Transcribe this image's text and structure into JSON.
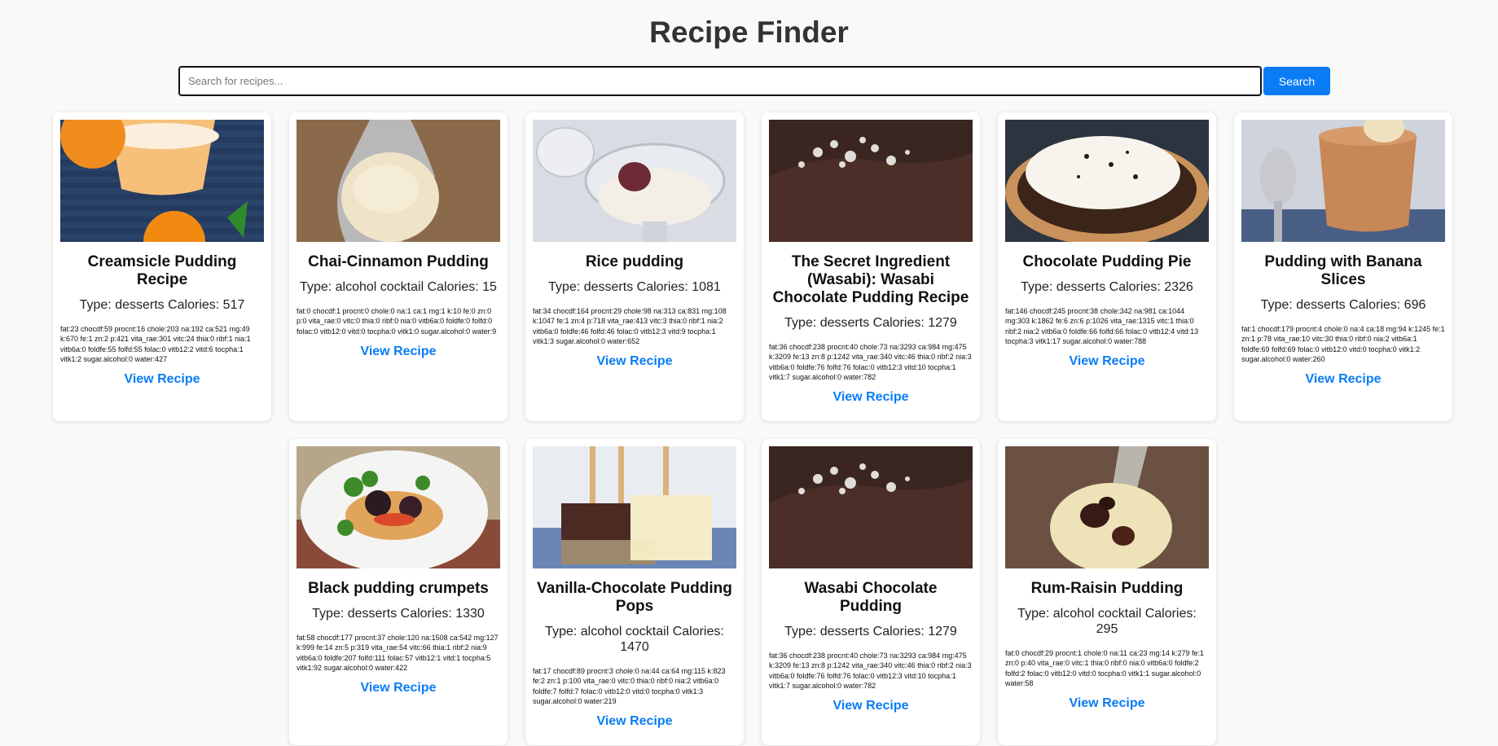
{
  "page": {
    "title": "Recipe Finder"
  },
  "search": {
    "placeholder": "Search for recipes...",
    "button_label": "Search"
  },
  "recipes": [
    {
      "title": "Creamsicle Pudding Recipe",
      "meta": "Type: desserts Calories: 517",
      "nutrients": "fat:23 chocdf:59 procnt:16 chole:203 na:192 ca:521 mg:49 k:670 fe:1 zn:2 p:421 vita_rae:301 vitc:24 thia:0 ribf:1 nia:1 vitb6a:0 foldfe:55 folfd:55 folac:0 vitb12:2 vitd:6 tocpha:1 vitk1:2 sugar.alcohol:0 water:427",
      "link": "View Recipe",
      "image": "creamsicle-pudding-photo"
    },
    {
      "title": "Chai-Cinnamon Pudding",
      "meta": "Type: alcohol cocktail Calories: 15",
      "nutrients": "fat:0 chocdf:1 procnt:0 chole:0 na:1 ca:1 mg:1 k:10 fe:0 zn:0 p:0 vita_rae:0 vitc:0 thia:0 ribf:0 nia:0 vitb6a:0 foldfe:0 folfd:0 folac:0 vitb12:0 vitd:0 tocpha:0 vitk1:0 sugar.alcohol:0 water:9",
      "link": "View Recipe",
      "image": "chai-pudding-photo"
    },
    {
      "title": "Rice pudding",
      "meta": "Type: desserts Calories: 1081",
      "nutrients": "fat:34 chocdf:164 procnt:29 chole:98 na:313 ca:831 mg:108 k:1047 fe:1 zn:4 p:718 vita_rae:413 vitc:3 thia:0 ribf:1 nia:2 vitb6a:0 foldfe:46 folfd:46 folac:0 vitb12:3 vitd:9 tocpha:1 vitk1:3 sugar.alcohol:0 water:652",
      "link": "View Recipe",
      "image": "rice-pudding-photo"
    },
    {
      "title": "The Secret Ingredient (Wasabi): Wasabi Chocolate Pudding Recipe",
      "meta": "Type: desserts Calories: 1279",
      "nutrients": "fat:36 chocdf:238 procnt:40 chole:73 na:3293 ca:984 mg:475 k:3209 fe:13 zn:8 p:1242 vita_rae:340 vitc:46 thia:0 ribf:2 nia:3 vitb6a:0 foldfe:76 folfd:76 folac:0 vitb12:3 vitd:10 tocpha:1 vitk1:7 sugar.alcohol:0 water:782",
      "link": "View Recipe",
      "image": "wasabi-chocolate-photo"
    },
    {
      "title": "Chocolate Pudding Pie",
      "meta": "Type: desserts Calories: 2326",
      "nutrients": "fat:146 chocdf:245 procnt:38 chole:342 na:981 ca:1044 mg:303 k:1862 fe:6 zn:6 p:1026 vita_rae:1315 vitc:1 thia:0 ribf:2 nia:2 vitb6a:0 foldfe:66 folfd:66 folac:0 vitb12:4 vitd:13 tocpha:3 vitk1:17 sugar.alcohol:0 water:788",
      "link": "View Recipe",
      "image": "chocolate-pie-photo"
    },
    {
      "title": "Pudding with Banana Slices",
      "meta": "Type: desserts Calories: 696",
      "nutrients": "fat:1 chocdf:179 procnt:4 chole:0 na:4 ca:18 mg:94 k:1245 fe:1 zn:1 p:78 vita_rae:10 vitc:30 thia:0 ribf:0 nia:2 vitb6a:1 foldfe:69 folfd:69 folac:0 vitb12:0 vitd:0 tocpha:0 vitk1:2 sugar.alcohol:0 water:260",
      "link": "View Recipe",
      "image": "banana-pudding-photo"
    },
    {
      "title": "Black pudding crumpets",
      "meta": "Type: desserts Calories: 1330",
      "nutrients": "fat:58 chocdf:177 procnt:37 chole:120 na:1508 ca:542 mg:127 k:999 fe:14 zn:5 p:319 vita_rae:54 vitc:66 thia:1 ribf:2 nia:9 vitb6a:0 foldfe:207 folfd:111 folac:57 vitb12:1 vitd:1 tocpha:5 vitk1:92 sugar.alcohol:0 water:422",
      "link": "View Recipe",
      "image": "black-pudding-photo"
    },
    {
      "title": "Vanilla-Chocolate Pudding Pops",
      "meta": "Type: alcohol cocktail Calories: 1470",
      "nutrients": "fat:17 chocdf:89 procnt:3 chole:0 na:44 ca:64 mg:115 k:823 fe:2 zn:1 p:100 vita_rae:0 vitc:0 thia:0 ribf:0 nia:2 vitb6a:0 foldfe:7 folfd:7 folac:0 vitb12:0 vitd:0 tocpha:0 vitk1:3 sugar.alcohol:0 water:219",
      "link": "View Recipe",
      "image": "pudding-pops-photo"
    },
    {
      "title": "Wasabi Chocolate Pudding",
      "meta": "Type: desserts Calories: 1279",
      "nutrients": "fat:36 chocdf:238 procnt:40 chole:73 na:3293 ca:984 mg:475 k:3209 fe:13 zn:8 p:1242 vita_rae:340 vitc:46 thia:0 ribf:2 nia:3 vitb6a:0 foldfe:76 folfd:76 folac:0 vitb12:3 vitd:10 tocpha:1 vitk1:7 sugar.alcohol:0 water:782",
      "link": "View Recipe",
      "image": "wasabi-chocolate-photo"
    },
    {
      "title": "Rum-Raisin Pudding",
      "meta": "Type: alcohol cocktail Calories: 295",
      "nutrients": "fat:0 chocdf:29 procnt:1 chole:0 na:11 ca:23 mg:14 k:279 fe:1 zn:0 p:40 vita_rae:0 vitc:1 thia:0 ribf:0 nia:0 vitb6a:0 foldfe:2 folfd:2 folac:0 vitb12:0 vitd:0 tocpha:0 vitk1:1 sugar.alcohol:0 water:58",
      "link": "View Recipe",
      "image": "rum-raisin-photo"
    }
  ]
}
